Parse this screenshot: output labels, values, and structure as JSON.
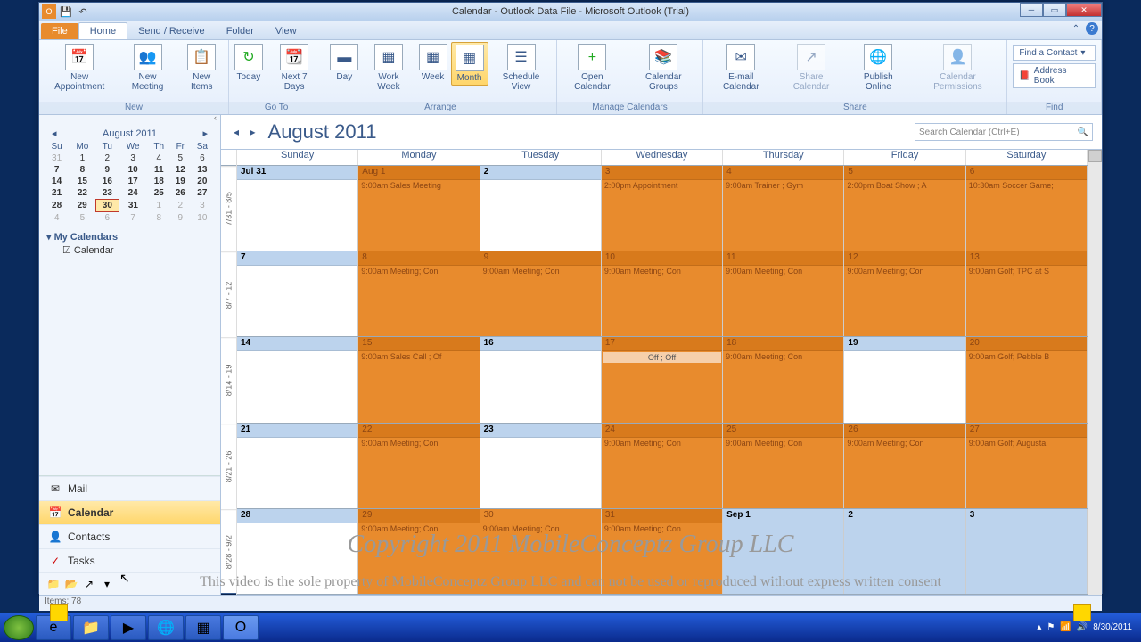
{
  "title": "Calendar - Outlook Data File - Microsoft Outlook (Trial)",
  "tabs": {
    "file": "File",
    "home": "Home",
    "sendrecv": "Send / Receive",
    "folder": "Folder",
    "view": "View"
  },
  "ribbon": {
    "new": {
      "label": "New",
      "appt": "New Appointment",
      "mtg": "New Meeting",
      "items": "New Items"
    },
    "goto": {
      "label": "Go To",
      "today": "Today",
      "next7": "Next 7 Days"
    },
    "arrange": {
      "label": "Arrange",
      "day": "Day",
      "workweek": "Work Week",
      "week": "Week",
      "month": "Month",
      "sched": "Schedule View"
    },
    "manage": {
      "label": "Manage Calendars",
      "open": "Open Calendar",
      "groups": "Calendar Groups"
    },
    "share": {
      "label": "Share",
      "email": "E-mail Calendar",
      "share": "Share Calendar",
      "publish": "Publish Online",
      "perms": "Calendar Permissions"
    },
    "find": {
      "label": "Find",
      "contact": "Find a Contact",
      "addr": "Address Book"
    }
  },
  "minical": {
    "title": "August 2011",
    "dow": [
      "Su",
      "Mo",
      "Tu",
      "We",
      "Th",
      "Fr",
      "Sa"
    ],
    "rows": [
      [
        "31",
        "1",
        "2",
        "3",
        "4",
        "5",
        "6"
      ],
      [
        "7",
        "8",
        "9",
        "10",
        "11",
        "12",
        "13"
      ],
      [
        "14",
        "15",
        "16",
        "17",
        "18",
        "19",
        "20"
      ],
      [
        "21",
        "22",
        "23",
        "24",
        "25",
        "26",
        "27"
      ],
      [
        "28",
        "29",
        "30",
        "31",
        "1",
        "2",
        "3"
      ],
      [
        "4",
        "5",
        "6",
        "7",
        "8",
        "9",
        "10"
      ]
    ]
  },
  "nav": {
    "mycal": "My Calendars",
    "cal": "Calendar",
    "mail": "Mail",
    "calendar": "Calendar",
    "contacts": "Contacts",
    "tasks": "Tasks"
  },
  "main": {
    "title": "August 2011",
    "search": "Search Calendar (Ctrl+E)",
    "dow": [
      "Sunday",
      "Monday",
      "Tuesday",
      "Wednesday",
      "Thursday",
      "Friday",
      "Saturday"
    ],
    "wk": [
      "7/31 - 8/5",
      "8/7 - 12",
      "8/14 - 19",
      "8/21 - 26",
      "8/28 - 9/2"
    ]
  },
  "cells": [
    [
      {
        "n": "Jul 31",
        "c": "w",
        "b": 1
      },
      {
        "n": "Aug 1",
        "c": "o",
        "ev": "9:00am   Sales Meeting"
      },
      {
        "n": "2",
        "c": "w",
        "b": 1,
        "hdr": "blue"
      },
      {
        "n": "3",
        "c": "o",
        "ev": "2:00pm   Appointment"
      },
      {
        "n": "4",
        "c": "o",
        "ev": "9:00am   Trainer ; Gym"
      },
      {
        "n": "5",
        "c": "o",
        "ev": "2:00pm   Boat Show ; A"
      },
      {
        "n": "6",
        "c": "o",
        "ev": "10:30am  Soccer Game;"
      }
    ],
    [
      {
        "n": "7",
        "c": "w",
        "b": 1
      },
      {
        "n": "8",
        "c": "o",
        "ev": "9:00am   Meeting; Con"
      },
      {
        "n": "9",
        "c": "o",
        "ev": "9:00am   Meeting; Con"
      },
      {
        "n": "10",
        "c": "o",
        "ev": "9:00am   Meeting; Con"
      },
      {
        "n": "11",
        "c": "o",
        "ev": "9:00am   Meeting; Con"
      },
      {
        "n": "12",
        "c": "o",
        "ev": "9:00am   Meeting; Con"
      },
      {
        "n": "13",
        "c": "o",
        "ev": "9:00am   Golf; TPC at S"
      }
    ],
    [
      {
        "n": "14",
        "c": "w",
        "b": 1
      },
      {
        "n": "15",
        "c": "o",
        "ev": "9:00am   Sales Call ; Of"
      },
      {
        "n": "16",
        "c": "w",
        "b": 1,
        "hdr": "blue"
      },
      {
        "n": "17",
        "c": "o",
        "off": "Off ; Off"
      },
      {
        "n": "18",
        "c": "o",
        "ev": "9:00am   Meeting; Con"
      },
      {
        "n": "19",
        "c": "w",
        "b": 1,
        "hdr": "blue"
      },
      {
        "n": "20",
        "c": "o",
        "ev": "9:00am   Golf; Pebble B"
      }
    ],
    [
      {
        "n": "21",
        "c": "w",
        "b": 1
      },
      {
        "n": "22",
        "c": "o",
        "ev": "9:00am   Meeting; Con"
      },
      {
        "n": "23",
        "c": "w",
        "b": 1,
        "hdr": "blue"
      },
      {
        "n": "24",
        "c": "o",
        "ev": "9:00am   Meeting; Con"
      },
      {
        "n": "25",
        "c": "o",
        "ev": "9:00am   Meeting; Con"
      },
      {
        "n": "26",
        "c": "o",
        "ev": "9:00am   Meeting; Con"
      },
      {
        "n": "27",
        "c": "o",
        "ev": "9:00am   Golf; Augusta"
      }
    ],
    [
      {
        "n": "28",
        "c": "w",
        "b": 1
      },
      {
        "n": "29",
        "c": "o",
        "ev": "9:00am   Meeting; Con"
      },
      {
        "n": "30",
        "c": "o",
        "ev": "9:00am   Meeting; Con",
        "hdr": "sel"
      },
      {
        "n": "31",
        "c": "o",
        "ev": "9:00am   Meeting; Con"
      },
      {
        "n": "Sep 1",
        "c": "b",
        "b": 1
      },
      {
        "n": "2",
        "c": "b",
        "b": 1
      },
      {
        "n": "3",
        "c": "b",
        "b": 1
      }
    ]
  ],
  "status": "Items: 78",
  "tray": {
    "time": "",
    "date": "8/30/2011"
  },
  "wm1": "Copyright 2011 MobileConceptz Group LLC",
  "wm2": "This video is the sole property of MobileConceptz Group LLC and can not be used or reproduced without express written consent"
}
